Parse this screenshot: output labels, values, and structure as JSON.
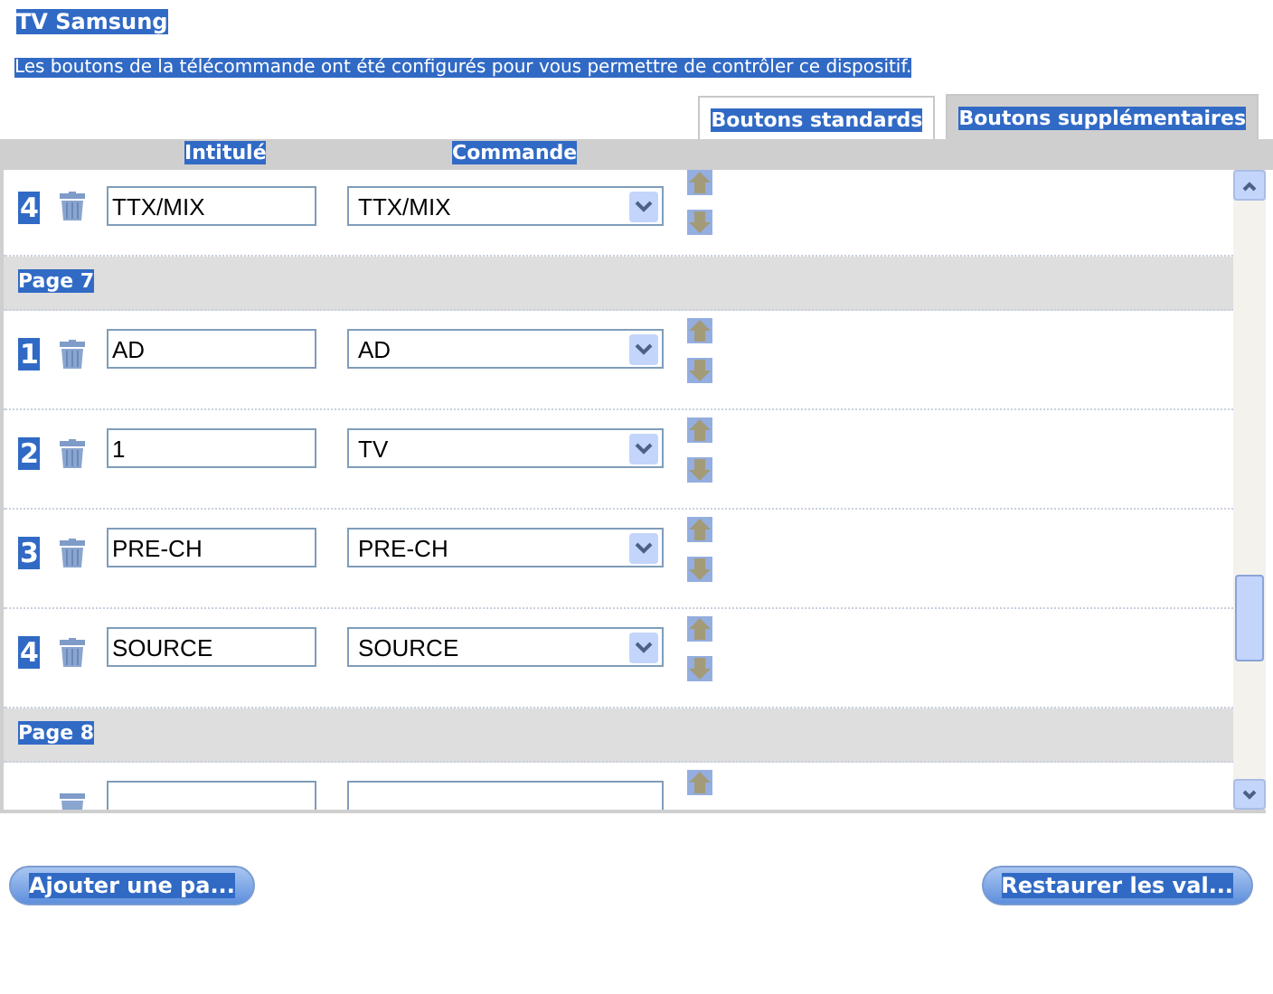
{
  "title": "TV Samsung",
  "description": "Les boutons de la télécommande ont été configurés pour vous permettre de contrôler ce dispositif.",
  "tabs": [
    {
      "label": "Boutons standards",
      "selected": false
    },
    {
      "label": "Boutons supplémentaires",
      "selected": true
    }
  ],
  "columns": [
    "Intitulé",
    "Commande"
  ],
  "list": [
    {
      "kind": "row",
      "number": "4",
      "label": "TTX/MIX",
      "command": "TTX/MIX"
    },
    {
      "kind": "page",
      "label": "Page 7"
    },
    {
      "kind": "row",
      "number": "1",
      "label": "AD",
      "command": "AD"
    },
    {
      "kind": "row",
      "number": "2",
      "label": "1",
      "command": "TV"
    },
    {
      "kind": "row",
      "number": "3",
      "label": "PRE-CH",
      "command": "PRE-CH"
    },
    {
      "kind": "row",
      "number": "4",
      "label": "SOURCE",
      "command": "SOURCE"
    },
    {
      "kind": "page",
      "label": "Page 8"
    },
    {
      "kind": "cut-row"
    }
  ],
  "buttons": [
    "Ajouter une pa...",
    "Restaurer les val..."
  ]
}
